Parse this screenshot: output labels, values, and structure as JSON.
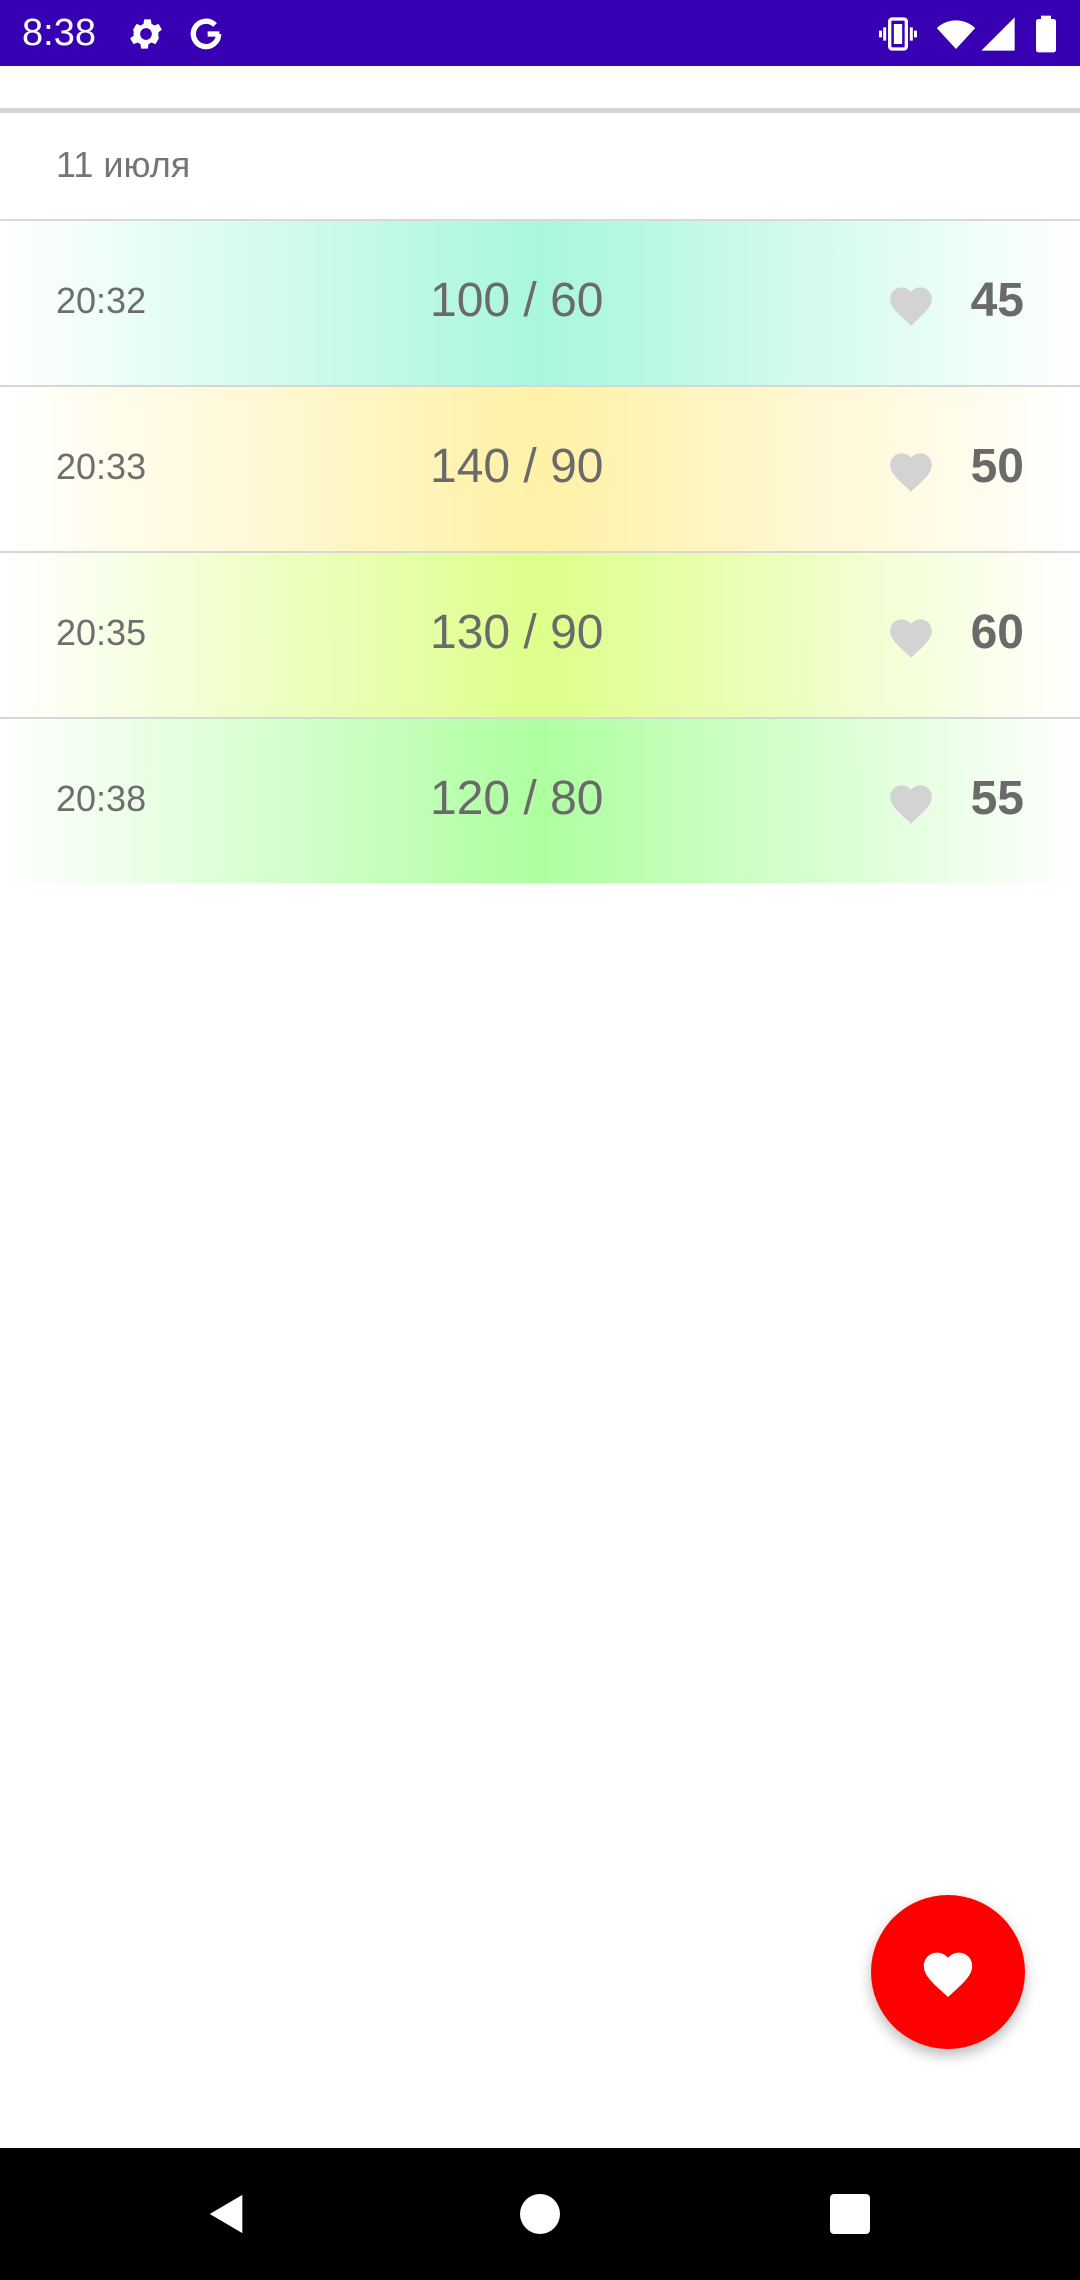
{
  "status_bar": {
    "time": "8:38",
    "background": "#3700b3",
    "icons_left": [
      "settings-icon",
      "google-icon"
    ],
    "icons_right": [
      "vibrate-icon",
      "wifi-icon",
      "signal-icon",
      "battery-icon"
    ]
  },
  "list": {
    "date_header": "11 июля",
    "rows": [
      {
        "time": "20:32",
        "pressure": "100 / 60",
        "pulse": "45",
        "color": "#a8f7dc"
      },
      {
        "time": "20:33",
        "pressure": "140 / 90",
        "pulse": "50",
        "color": "#fff1a6"
      },
      {
        "time": "20:35",
        "pressure": "130 / 90",
        "pulse": "60",
        "color": "#ddff8a"
      },
      {
        "time": "20:38",
        "pressure": "120 / 80",
        "pulse": "55",
        "color": "#aeffa0"
      }
    ]
  },
  "fab": {
    "icon": "heart-icon",
    "color": "#ff0000"
  },
  "nav_bar": {
    "buttons": [
      "back-icon",
      "home-icon",
      "recents-icon"
    ]
  }
}
